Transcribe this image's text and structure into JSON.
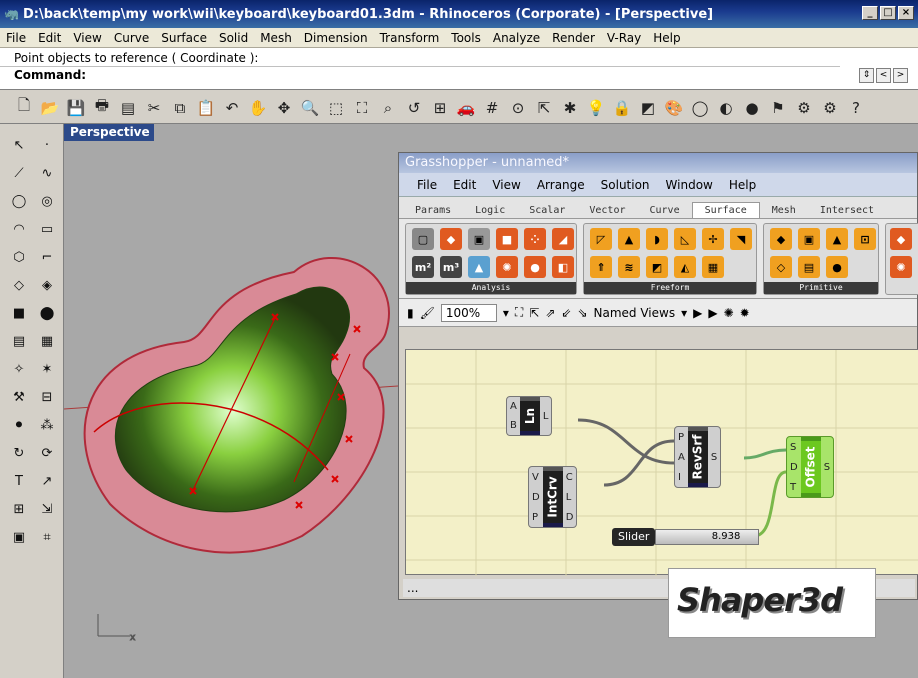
{
  "window": {
    "title": "D:\\back\\temp\\my work\\wii\\keyboard\\keyboard01.3dm - Rhinoceros (Corporate) - [Perspective]"
  },
  "menu": [
    "File",
    "Edit",
    "View",
    "Curve",
    "Surface",
    "Solid",
    "Mesh",
    "Dimension",
    "Transform",
    "Tools",
    "Analyze",
    "Render",
    "V-Ray",
    "Help"
  ],
  "command": {
    "history": "Point objects to reference ( Coordinate ):",
    "prompt": "Command:"
  },
  "viewport": {
    "label": "Perspective"
  },
  "grasshopper": {
    "title": "Grasshopper - unnamed*",
    "menu": [
      "File",
      "Edit",
      "View",
      "Arrange",
      "Solution",
      "Window",
      "Help"
    ],
    "tabs": [
      "Params",
      "Logic",
      "Scalar",
      "Vector",
      "Curve",
      "Surface",
      "Mesh",
      "Intersect"
    ],
    "active_tab": "Surface",
    "panels": [
      "Analysis",
      "Freeform",
      "Primitive"
    ],
    "analysis_labels": [
      "m²",
      "m³"
    ],
    "zoom": "100%",
    "named_views": "Named Views",
    "status": "...",
    "components": {
      "ln": {
        "name": "Ln",
        "inputs": [
          "A",
          "B"
        ],
        "outputs": [
          "L"
        ]
      },
      "revsrf": {
        "name": "RevSrf",
        "inputs": [
          "P",
          "A",
          "I"
        ],
        "outputs": [
          "S"
        ]
      },
      "intcrv": {
        "name": "IntCrv",
        "inputs": [
          "V",
          "D",
          "P"
        ],
        "outputs": [
          "C",
          "L",
          "D"
        ]
      },
      "offset": {
        "name": "Offset",
        "inputs": [
          "S",
          "D",
          "T"
        ],
        "outputs": [
          "S"
        ]
      }
    },
    "slider": {
      "label": "Slider",
      "value": "8.938"
    }
  },
  "watermark": "Shaper3d",
  "colors": {
    "title_bar": "#0a246a",
    "viewport_bg": "#a8a8a8",
    "canvas_bg": "#f3f0c8",
    "offset_green": "#6cc820"
  }
}
